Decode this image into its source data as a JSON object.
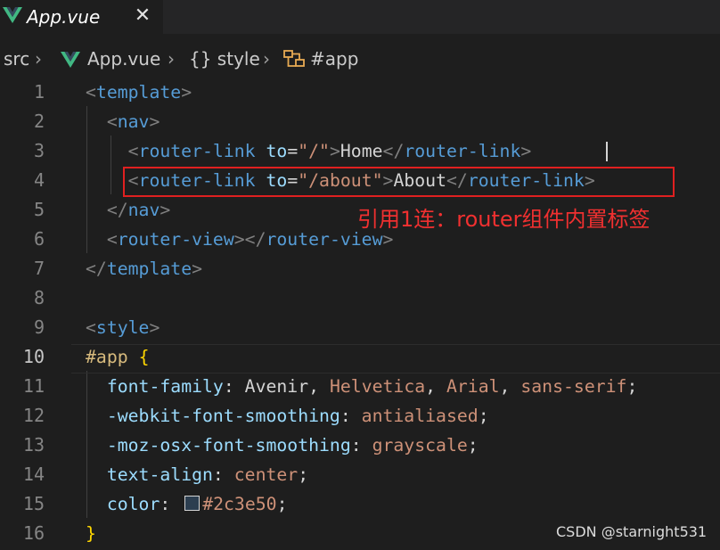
{
  "tab": {
    "title": "App.vue",
    "close_glyph": "✕"
  },
  "breadcrumb": {
    "items": [
      "src",
      "App.vue",
      "{} style",
      "#app"
    ],
    "separator": "›"
  },
  "editor": {
    "active_line": "10",
    "lines": [
      {
        "number": "1",
        "tokens": [
          [
            "<",
            "t-punct"
          ],
          [
            "template",
            "t-tag"
          ],
          [
            ">",
            "t-punct"
          ]
        ]
      },
      {
        "number": "2",
        "tokens": [
          [
            "  <",
            "t-punct"
          ],
          [
            "nav",
            "t-tag"
          ],
          [
            ">",
            "t-punct"
          ]
        ]
      },
      {
        "number": "3",
        "tokens": [
          [
            "    <",
            "t-punct"
          ],
          [
            "router-link",
            "t-tag"
          ],
          [
            " ",
            "t-text"
          ],
          [
            "to",
            "t-attr"
          ],
          [
            "=",
            "t-text"
          ],
          [
            "\"/\"",
            "t-str"
          ],
          [
            ">",
            "t-punct"
          ],
          [
            "Home",
            "t-text"
          ],
          [
            "</",
            "t-punct"
          ],
          [
            "router-link",
            "t-tag"
          ],
          [
            ">",
            "t-punct"
          ]
        ]
      },
      {
        "number": "4",
        "tokens": [
          [
            "    <",
            "t-punct"
          ],
          [
            "router-link",
            "t-tag"
          ],
          [
            " ",
            "t-text"
          ],
          [
            "to",
            "t-attr"
          ],
          [
            "=",
            "t-text"
          ],
          [
            "\"/about\"",
            "t-str"
          ],
          [
            ">",
            "t-punct"
          ],
          [
            "About",
            "t-text"
          ],
          [
            "</",
            "t-punct"
          ],
          [
            "router-link",
            "t-tag"
          ],
          [
            ">",
            "t-punct"
          ]
        ]
      },
      {
        "number": "5",
        "tokens": [
          [
            "  </",
            "t-punct"
          ],
          [
            "nav",
            "t-tag"
          ],
          [
            ">",
            "t-punct"
          ]
        ]
      },
      {
        "number": "6",
        "tokens": [
          [
            "  <",
            "t-punct"
          ],
          [
            "router-view",
            "t-tag"
          ],
          [
            "></",
            "t-punct"
          ],
          [
            "router-view",
            "t-tag"
          ],
          [
            ">",
            "t-punct"
          ]
        ]
      },
      {
        "number": "7",
        "tokens": [
          [
            "</",
            "t-punct"
          ],
          [
            "template",
            "t-tag"
          ],
          [
            ">",
            "t-punct"
          ]
        ]
      },
      {
        "number": "8",
        "tokens": []
      },
      {
        "number": "9",
        "tokens": [
          [
            "<",
            "t-punct"
          ],
          [
            "style",
            "t-tag"
          ],
          [
            ">",
            "t-punct"
          ]
        ]
      },
      {
        "number": "10",
        "tokens": [
          [
            "#app",
            "t-sel"
          ],
          [
            " ",
            "t-text"
          ],
          [
            "{",
            "t-brace"
          ]
        ]
      },
      {
        "number": "11",
        "tokens": [
          [
            "  ",
            "t-text"
          ],
          [
            "font-family",
            "t-prop"
          ],
          [
            ": ",
            "t-text"
          ],
          [
            "Avenir",
            "t-text"
          ],
          [
            ", ",
            "t-text"
          ],
          [
            "Helvetica",
            "t-val"
          ],
          [
            ", ",
            "t-text"
          ],
          [
            "Arial",
            "t-val"
          ],
          [
            ", ",
            "t-text"
          ],
          [
            "sans-serif",
            "t-val"
          ],
          [
            ";",
            "t-text"
          ]
        ]
      },
      {
        "number": "12",
        "tokens": [
          [
            "  ",
            "t-text"
          ],
          [
            "-webkit-font-smoothing",
            "t-prop"
          ],
          [
            ": ",
            "t-text"
          ],
          [
            "antialiased",
            "t-val"
          ],
          [
            ";",
            "t-text"
          ]
        ]
      },
      {
        "number": "13",
        "tokens": [
          [
            "  ",
            "t-text"
          ],
          [
            "-moz-osx-font-smoothing",
            "t-prop"
          ],
          [
            ": ",
            "t-text"
          ],
          [
            "grayscale",
            "t-val"
          ],
          [
            ";",
            "t-text"
          ]
        ]
      },
      {
        "number": "14",
        "tokens": [
          [
            "  ",
            "t-text"
          ],
          [
            "text-align",
            "t-prop"
          ],
          [
            ": ",
            "t-text"
          ],
          [
            "center",
            "t-val"
          ],
          [
            ";",
            "t-text"
          ]
        ]
      },
      {
        "number": "15",
        "tokens": [
          [
            "  ",
            "t-text"
          ],
          [
            "color",
            "t-prop"
          ],
          [
            ": ",
            "t-text"
          ],
          [
            "SWATCH",
            "swatch"
          ],
          [
            "#2c3e50",
            "t-val"
          ],
          [
            ";",
            "t-text"
          ]
        ]
      },
      {
        "number": "16",
        "tokens": [
          [
            "}",
            "t-brace"
          ]
        ]
      }
    ]
  },
  "annotation": "引用1连：router组件内置标签",
  "watermark": "CSDN @starnight531",
  "colors": {
    "background": "#1e1e1e",
    "highlight_border": "#e02020",
    "annotation_text": "#f03030",
    "swatch": "#2c3e50"
  }
}
